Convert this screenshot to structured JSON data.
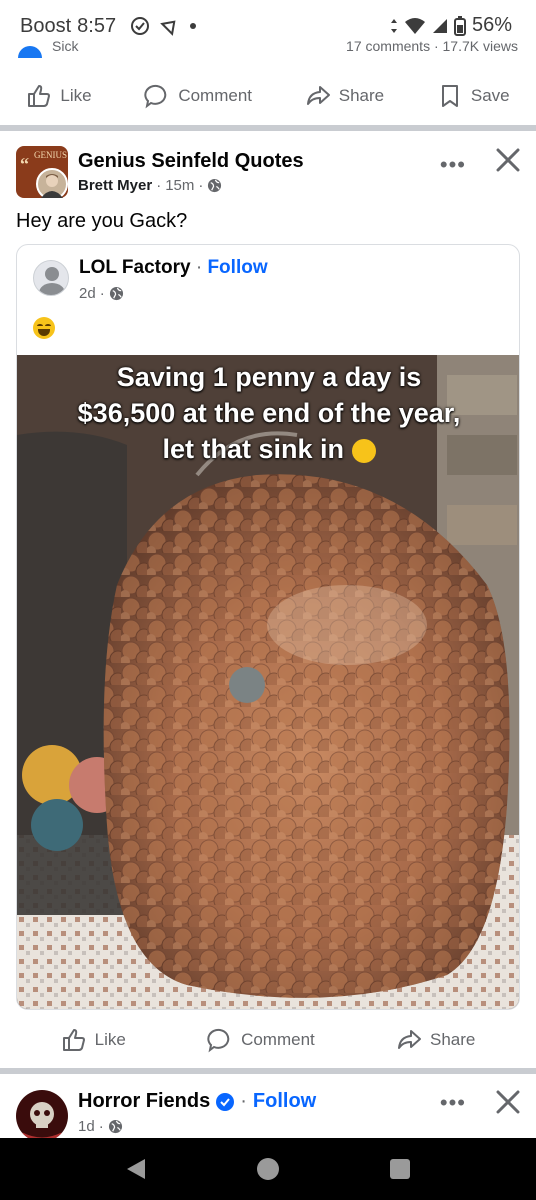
{
  "status_bar": {
    "carrier": "Boost",
    "time": "8:57",
    "battery": "56%"
  },
  "previous_post": {
    "stats_left": "Sick",
    "stats_right": "17 comments · 17.7K views"
  },
  "actions_top": {
    "like": "Like",
    "comment": "Comment",
    "share": "Share",
    "save": "Save"
  },
  "post": {
    "group_name": "Genius Seinfeld Quotes",
    "group_avatar_text": "GENIUS",
    "author": "Brett Myer",
    "time": "15m",
    "text": "Hey are you Gack?",
    "more": "•••"
  },
  "shared": {
    "page_name": "LOL Factory",
    "separator": "·",
    "follow": "Follow",
    "time": "2d",
    "photo_caption_lines": [
      "Saving 1 penny a day is",
      "$36,500 at the end of the year,",
      "let that sink in"
    ]
  },
  "actions_bottom": {
    "like": "Like",
    "comment": "Comment",
    "share": "Share"
  },
  "next_post": {
    "page_name": "Horror Fiends",
    "separator": "·",
    "follow": "Follow",
    "time": "1d",
    "more": "•••"
  },
  "colors": {
    "link_blue": "#0866ff",
    "icon_gray": "#65676b",
    "separator_gray": "#c9ccd1"
  }
}
